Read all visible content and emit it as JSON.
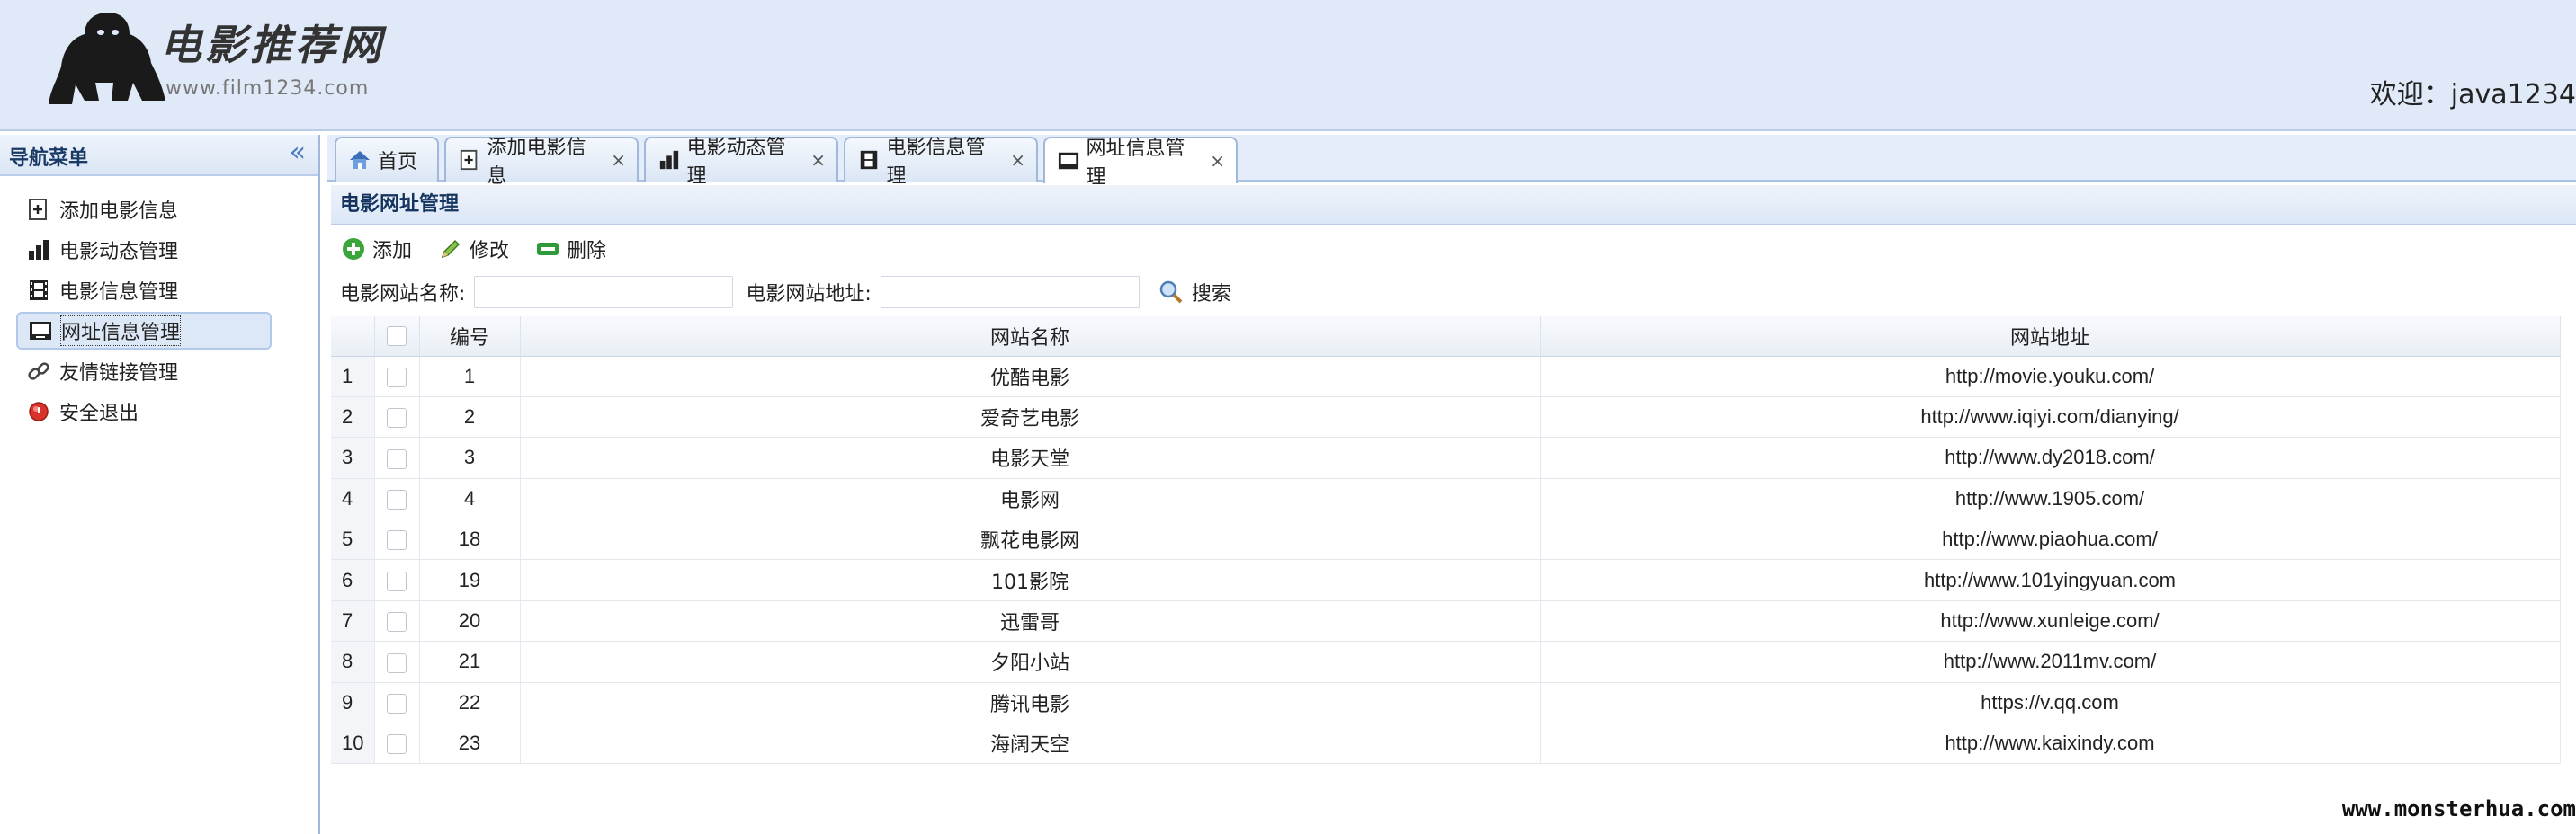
{
  "header": {
    "logo_text": "电影推荐网",
    "logo_url": "www.film1234.com",
    "welcome": "欢迎：java1234"
  },
  "nav": {
    "title": "导航菜单",
    "items": [
      {
        "label": "添加电影信息",
        "icon": "add-document-icon"
      },
      {
        "label": "电影动态管理",
        "icon": "bar-chart-icon"
      },
      {
        "label": "电影信息管理",
        "icon": "film-icon"
      },
      {
        "label": "网址信息管理",
        "icon": "monitor-icon",
        "active": true
      },
      {
        "label": "友情链接管理",
        "icon": "link-icon"
      },
      {
        "label": "安全退出",
        "icon": "exit-icon"
      }
    ]
  },
  "tabs": [
    {
      "label": "首页",
      "icon": "home-icon",
      "closable": false
    },
    {
      "label": "添加电影信息",
      "icon": "add-document-icon",
      "closable": true
    },
    {
      "label": "电影动态管理",
      "icon": "bar-chart-icon",
      "closable": true
    },
    {
      "label": "电影信息管理",
      "icon": "film-icon",
      "closable": true
    },
    {
      "label": "网址信息管理",
      "icon": "monitor-icon",
      "closable": true,
      "active": true
    }
  ],
  "tab_close_glyph": "×",
  "panel": {
    "title": "电影网址管理",
    "toolbar": {
      "add": "添加",
      "edit": "修改",
      "delete": "删除"
    },
    "search": {
      "name_label": "电影网站名称:",
      "url_label": "电影网站地址:",
      "button": "搜索"
    }
  },
  "table": {
    "headers": {
      "id": "编号",
      "name": "网站名称",
      "url": "网站地址"
    },
    "rows": [
      {
        "n": "1",
        "id": "1",
        "name": "优酷电影",
        "url": "http://movie.youku.com/"
      },
      {
        "n": "2",
        "id": "2",
        "name": "爱奇艺电影",
        "url": "http://www.iqiyi.com/dianying/"
      },
      {
        "n": "3",
        "id": "3",
        "name": "电影天堂",
        "url": "http://www.dy2018.com/"
      },
      {
        "n": "4",
        "id": "4",
        "name": "电影网",
        "url": "http://www.1905.com/"
      },
      {
        "n": "5",
        "id": "18",
        "name": "飘花电影网",
        "url": "http://www.piaohua.com/"
      },
      {
        "n": "6",
        "id": "19",
        "name": "101影院",
        "url": "http://www.101yingyuan.com"
      },
      {
        "n": "7",
        "id": "20",
        "name": "迅雷哥",
        "url": "http://www.xunleige.com/"
      },
      {
        "n": "8",
        "id": "21",
        "name": "夕阳小站",
        "url": "http://www.2011mv.com/"
      },
      {
        "n": "9",
        "id": "22",
        "name": "腾讯电影",
        "url": "https://v.qq.com"
      },
      {
        "n": "10",
        "id": "23",
        "name": "海阔天空",
        "url": "http://www.kaixindy.com"
      }
    ]
  },
  "watermark": "www.monsterhua.com",
  "colors": {
    "accent": "#4a7bc0",
    "header_bg": "#dfe9f7",
    "add_green": "#3aa53a",
    "delete_green": "#2f9a3a",
    "exit_red": "#d9342b"
  }
}
